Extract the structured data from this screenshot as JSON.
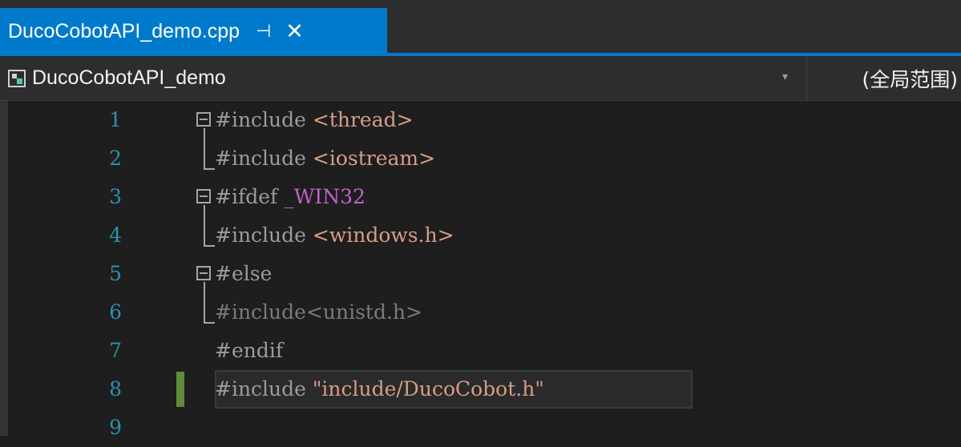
{
  "tab": {
    "title": "DucoCobotAPI_demo.cpp",
    "pin_glyph": "⊣",
    "close_glyph": "✕"
  },
  "navbar": {
    "project": "DucoCobotAPI_demo",
    "dropdown_glyph": "▾",
    "scope": "(全局范围)"
  },
  "icons": {
    "project": "project-icon",
    "pin": "pin-icon",
    "close": "close-icon",
    "fold": "collapse-icon"
  },
  "colors": {
    "tab_active": "#007acc",
    "background": "#1e1e1e",
    "line_number": "#2b91af",
    "preprocessor": "#9b9b9b",
    "string": "#d69d85",
    "macro": "#bd63c5",
    "change_mark": "#5f8d3a"
  },
  "editor": {
    "lines": [
      {
        "number": "1",
        "directive": "#include ",
        "arg": "<thread>"
      },
      {
        "number": "2",
        "directive": "#include ",
        "arg": "<iostream>"
      },
      {
        "number": "3",
        "directive": "#ifdef ",
        "arg": "_WIN32"
      },
      {
        "number": "4",
        "directive": "#include ",
        "arg": "<windows.h>"
      },
      {
        "number": "5",
        "directive": "#else",
        "arg": ""
      },
      {
        "number": "6",
        "directive": "#include",
        "arg": "<unistd.h>"
      },
      {
        "number": "7",
        "directive": "#endif",
        "arg": ""
      },
      {
        "number": "8",
        "directive": "#include ",
        "arg": "\"include/DucoCobot.h\""
      },
      {
        "number": "9",
        "directive": "",
        "arg": ""
      }
    ]
  }
}
